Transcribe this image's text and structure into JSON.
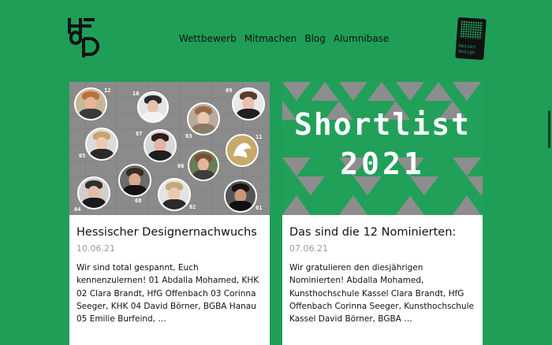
{
  "colors": {
    "background": "#1f9e58",
    "card": "#ffffff",
    "date": "#9a9a9a"
  },
  "header": {
    "logo_icon": "hessen-design-monogram",
    "nav": [
      {
        "label": "Wettbewerb"
      },
      {
        "label": "Mitmachen"
      },
      {
        "label": "Blog"
      },
      {
        "label": "Alumnibase"
      }
    ],
    "badge": {
      "icon": "hessen-design-badge",
      "line1": "hessen",
      "line2": "design"
    }
  },
  "posts": [
    {
      "title": "Hessischer Designernachwuchs",
      "date": "10.06.21",
      "excerpt": "Wir sind total gespannt, Euch kennenzulernen! 01 Abdalla Mohamed, KHK 02 Clara Brandt, HfG Offenbach 03 Corinna Seeger, KHK 04 David Börner, BGBA Hanau 05 Emilie Burfeind, …",
      "image": {
        "type": "photo-grid",
        "labels": [
          "12",
          "10",
          "09",
          "07",
          "03",
          "11",
          "05",
          "06",
          "04",
          "08",
          "02",
          "01"
        ]
      }
    },
    {
      "title": "Das sind die 12 Nominierten:",
      "date": "07.06.21",
      "excerpt": "Wir gratulieren den diesjährigen Nominierten! Abdalla Mohamed, Kunsthochschule Kassel Clara Brandt, HfG Offenbach Corinna Seeger, Kunsthochschule Kassel David Börner, BGBA …",
      "image": {
        "type": "banner",
        "line1": "Shortlist",
        "line2": "2021"
      }
    }
  ]
}
